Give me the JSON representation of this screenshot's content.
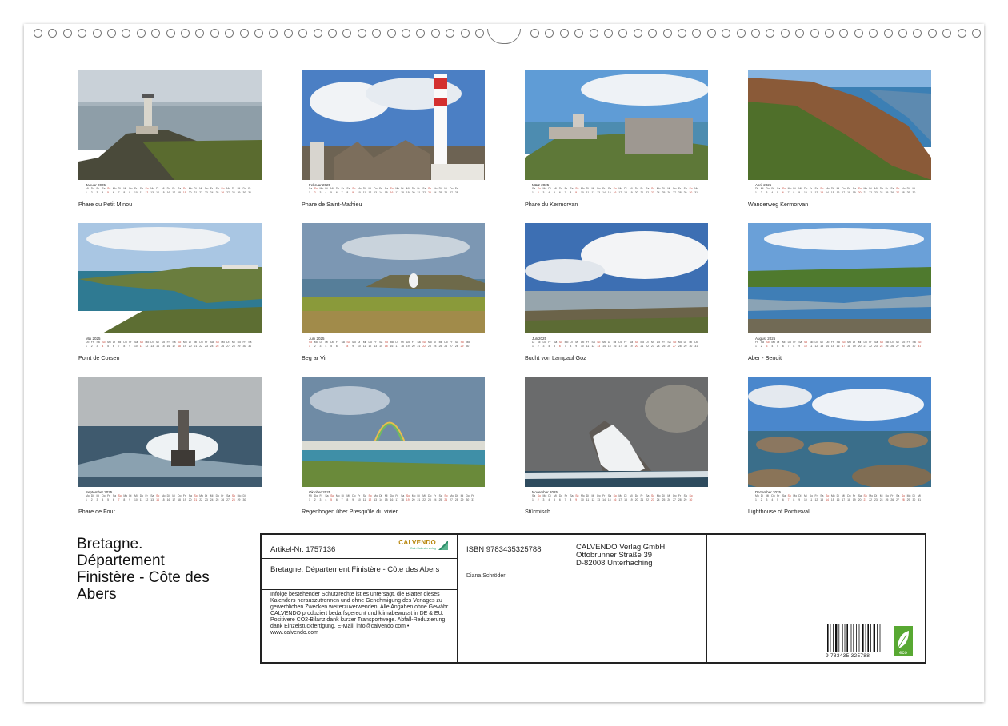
{
  "calendar": {
    "weekdays": [
      "Mi",
      "Do",
      "Fr",
      "Sa",
      "So",
      "Mo",
      "Di"
    ],
    "months": [
      {
        "label": "Januar 2025",
        "caption": "Phare du Petit Minou",
        "days": 31,
        "start": 0
      },
      {
        "label": "Februar 2025",
        "caption": "Phare de Saint-Mathieu",
        "days": 28,
        "start": 3
      },
      {
        "label": "März 2025",
        "caption": "Phare du Kermorvan",
        "days": 31,
        "start": 3
      },
      {
        "label": "April 2025",
        "caption": "Wanderweg Kermorvan",
        "days": 30,
        "start": 6
      },
      {
        "label": "Mai 2025",
        "caption": "Point de Corsen",
        "days": 31,
        "start": 1
      },
      {
        "label": "Juni 2025",
        "caption": "Beg ar Vir",
        "days": 30,
        "start": 4
      },
      {
        "label": "Juli 2025",
        "caption": "Bucht von Lampaul Goz",
        "days": 31,
        "start": 6
      },
      {
        "label": "August 2025",
        "caption": "Aber - Benoit",
        "days": 31,
        "start": 2
      },
      {
        "label": "September 2025",
        "caption": "Phare de Four",
        "days": 30,
        "start": 5
      },
      {
        "label": "Oktober 2025",
        "caption": "Regenbogen über Presqu'île du vivier",
        "days": 31,
        "start": 0
      },
      {
        "label": "November 2025",
        "caption": "Stürmisch",
        "days": 30,
        "start": 3
      },
      {
        "label": "Dezember 2025",
        "caption": "Lighthouse of Pontusval",
        "days": 31,
        "start": 5
      }
    ]
  },
  "title": {
    "lines": [
      "Bretagne.",
      "Département",
      "Finistère - Côte des",
      "Abers"
    ]
  },
  "info": {
    "artikel": "Artikel-Nr. 1757136",
    "logo_text": "CALVENDO",
    "logo_sub": "Dein Kalenderverlag",
    "subtitle": "Bretagne. Département Finistère - Côte des Abers",
    "legal": "Infolge bestehender Schutzrechte ist es untersagt, die Blätter dieses Kalenders herauszutrennen und ohne Genehmigung des Verlages zu gewerblichen Zwecken weiterzuverwenden. Alle Angaben ohne Gewähr. CALVENDO produziert bedarfsgerecht und klimabewusst in DE & EU. Positivere CO2-Bilanz dank kurzer Transportwege. Abfall-Reduzierung dank Einzelstückfertigung. E-Mail: info@calvendo.com • www.calvendo.com",
    "isbn": "ISBN 9783435325788",
    "author": "Diana Schröder",
    "publisher_lines": [
      "CALVENDO Verlag GmbH",
      "Ottobrunner Straße 39",
      "D-82008 Unterhaching"
    ],
    "barcode_number": "9 783435 325788",
    "eco_label": "eco"
  },
  "colors": {
    "sky": "#6d9ed4",
    "sea": "#3d6f8e",
    "grass": "#7a8f3c",
    "sunday": "#c0392b"
  }
}
